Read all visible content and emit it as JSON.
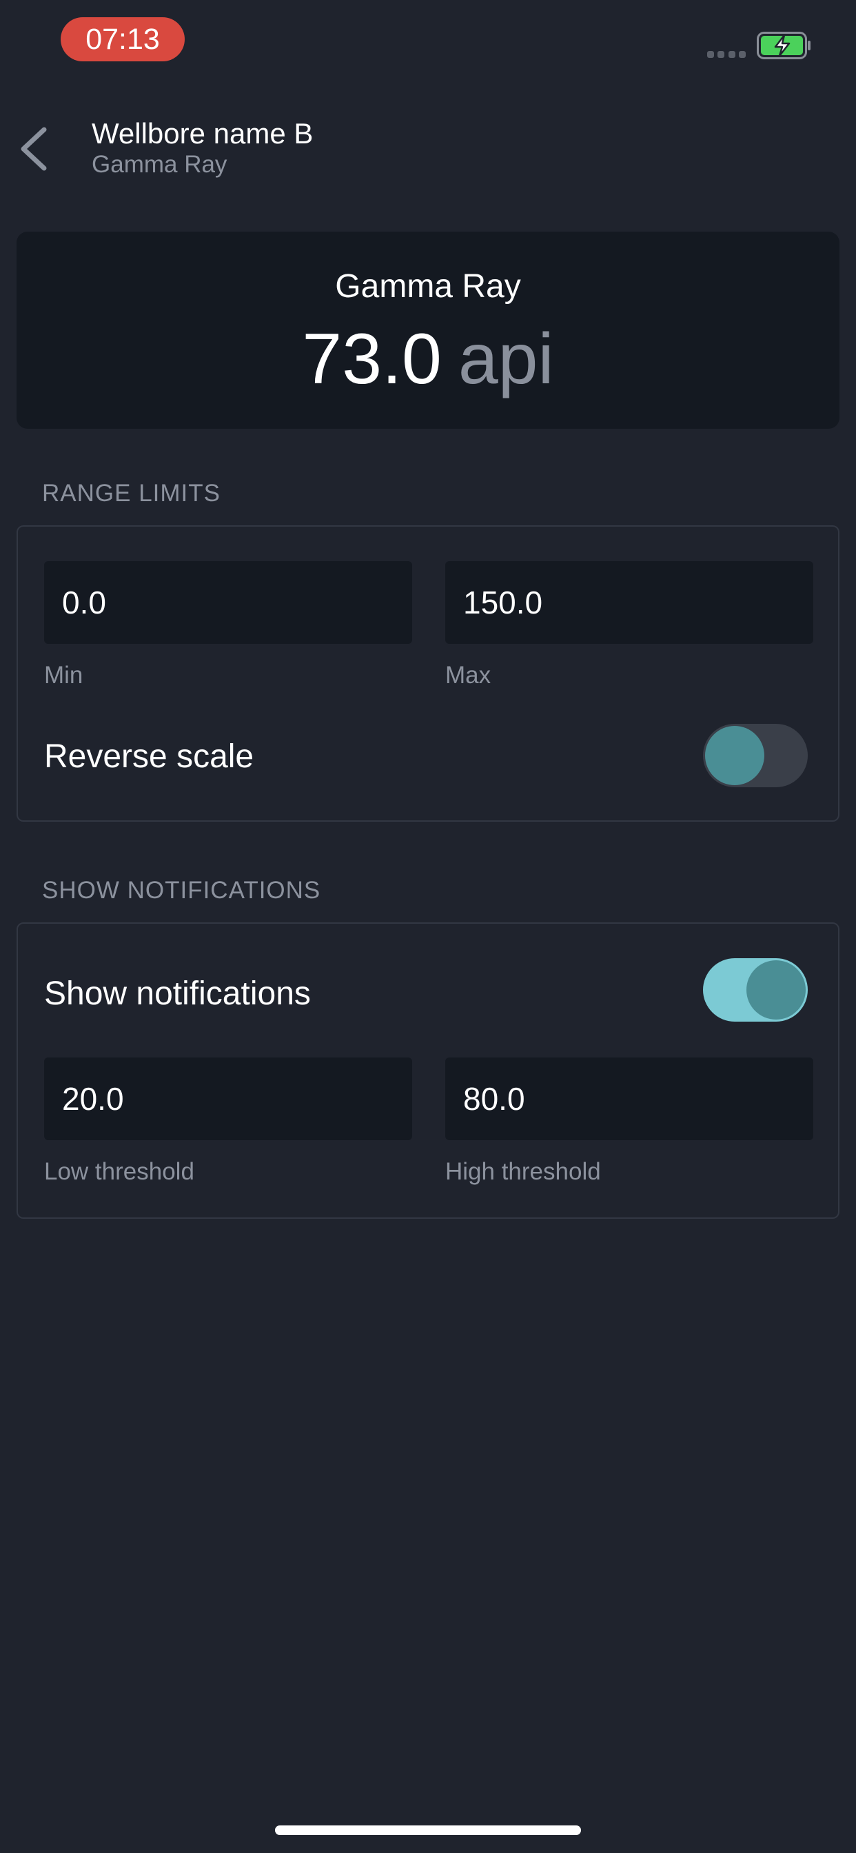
{
  "status_bar": {
    "time": "07:13",
    "battery_color": "#4bd15b"
  },
  "header": {
    "title": "Wellbore name B",
    "subtitle": "Gamma Ray",
    "back_icon": "chevron-left-icon"
  },
  "reading": {
    "label": "Gamma Ray",
    "value": "73.0",
    "unit": "api"
  },
  "range_limits": {
    "section_title": "RANGE LIMITS",
    "min_value": "0.0",
    "min_label": "Min",
    "max_value": "150.0",
    "max_label": "Max",
    "reverse_scale_label": "Reverse scale",
    "reverse_scale_on": false
  },
  "notifications": {
    "section_title": "SHOW NOTIFICATIONS",
    "toggle_label": "Show notifications",
    "toggle_on": true,
    "low_value": "20.0",
    "low_label": "Low threshold",
    "high_value": "80.0",
    "high_label": "High threshold"
  },
  "colors": {
    "background": "#1f232d",
    "card": "#141921",
    "accent": "#7ccad4",
    "knob": "#4a8e95",
    "time_pill": "#d9493f"
  }
}
